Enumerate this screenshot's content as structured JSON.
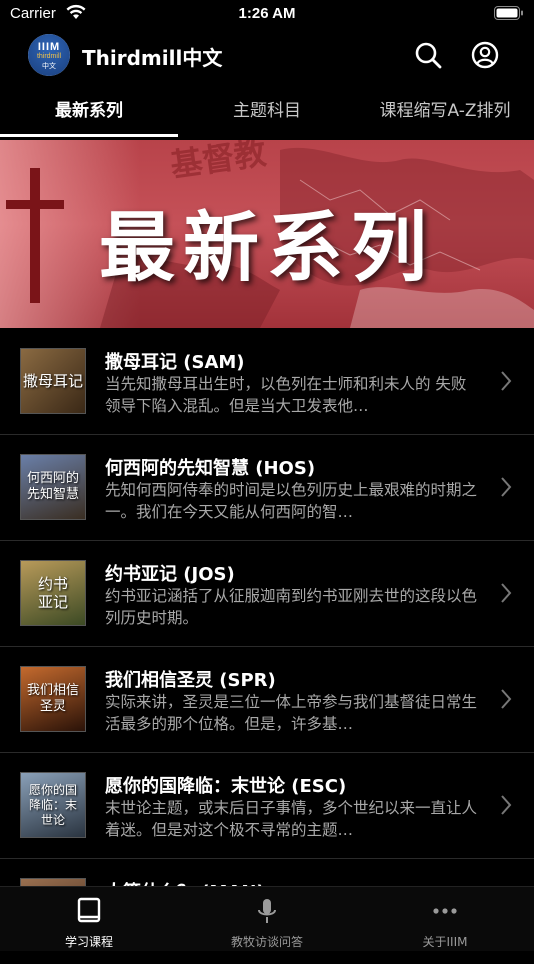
{
  "status_bar": {
    "carrier": "Carrier",
    "time": "1:26 AM"
  },
  "header": {
    "title": "Thirdmill中文",
    "logo": {
      "line1": "IIIM",
      "line2": "thirdmill",
      "line3": "中文"
    },
    "icons": [
      "search-icon",
      "profile-icon"
    ]
  },
  "tabs": [
    {
      "label": "最新系列",
      "active": true
    },
    {
      "label": "主题科目",
      "active": false
    },
    {
      "label": "课程缩写A-Z排列",
      "active": false
    }
  ],
  "banner": {
    "title": "最新系列",
    "faint_text": "基督教"
  },
  "courses": [
    {
      "title": "撒母耳记 (SAM)",
      "desc": "当先知撒母耳出生时，以色列在士师和利未人的 失败领导下陷入混乱。但是当大卫发表他…",
      "thumb_text": "撒母耳记",
      "thumb_color": "#6b4a2a"
    },
    {
      "title": "何西阿的先知智慧 (HOS)",
      "desc": "先知何西阿侍奉的时间是以色列历史上最艰难的时期之一。我们在今天又能从何西阿的智…",
      "thumb_text": "何西阿的先知智慧",
      "thumb_color": "#3d4a6a"
    },
    {
      "title": "约书亚记 (JOS)",
      "desc": "约书亚记涵括了从征服迦南到约书亚刚去世的这段以色列历史时期。",
      "thumb_text": "约书亚记",
      "thumb_color": "#4a5a2e"
    },
    {
      "title": "我们相信圣灵 (SPR)",
      "desc": "实际来讲，圣灵是三位一体上帝参与我们基督徒日常生活最多的那个位格。但是，许多基…",
      "thumb_text": "我们相信圣灵",
      "thumb_color": "#5a2e1a"
    },
    {
      "title": "愿你的国降临：末世论 (ESC)",
      "desc": "末世论主题，或末后日子事情，多个世纪以来一直让人着迷。但是对这个极不寻常的主题…",
      "thumb_text": "愿你的国降临：末世论",
      "thumb_color": "#3a4a5a"
    },
    {
      "title": "人算什么？ (MAN)",
      "desc": "",
      "thumb_text": "",
      "thumb_color": "#5a3a2a"
    }
  ],
  "tabbar": [
    {
      "label": "学习课程",
      "icon": "book-icon",
      "active": true
    },
    {
      "label": "教牧访谈问答",
      "icon": "microphone-icon",
      "active": false
    },
    {
      "label": "关于IIIM",
      "icon": "more-icon",
      "active": false
    }
  ]
}
